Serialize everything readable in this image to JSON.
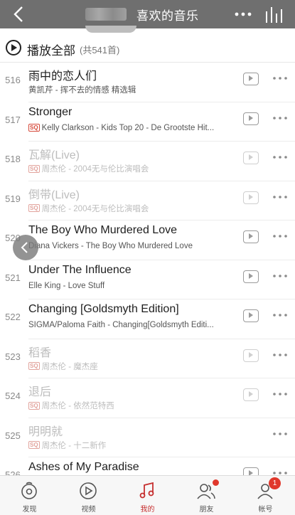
{
  "header": {
    "title": "喜欢的音乐"
  },
  "play_all": {
    "label": "播放全部",
    "count": "(共541首)"
  },
  "songs": [
    {
      "index": "516",
      "name": "雨中的恋人们",
      "sub": "黄凯芹 - 挥不去的情感 精选辑",
      "sq": false,
      "mv": true,
      "available": true
    },
    {
      "index": "517",
      "name": "Stronger",
      "sub": "Kelly Clarkson - Kids Top 20 - De Grootste Hit...",
      "sq": true,
      "mv": true,
      "available": true
    },
    {
      "index": "518",
      "name": "瓦解(Live)",
      "sub": "周杰伦 - 2004无与伦比演唱会",
      "sq": true,
      "mv": true,
      "available": false
    },
    {
      "index": "519",
      "name": "倒带(Live)",
      "sub": "周杰伦 - 2004无与伦比演唱会",
      "sq": true,
      "mv": true,
      "available": false
    },
    {
      "index": "520",
      "name": "The Boy Who Murdered Love",
      "sub": "Diana Vickers - The Boy Who Murdered Love",
      "sq": false,
      "mv": true,
      "available": true
    },
    {
      "index": "521",
      "name": "Under The Influence",
      "sub": "Elle King - Love Stuff",
      "sq": false,
      "mv": true,
      "available": true
    },
    {
      "index": "522",
      "name": "Changing [Goldsmyth Edition]",
      "sub": "SIGMA/Paloma Faith - Changing[Goldsmyth Editi...",
      "sq": false,
      "mv": true,
      "available": true
    },
    {
      "index": "523",
      "name": "稻香",
      "sub": "周杰伦 - 魔杰座",
      "sq": true,
      "mv": true,
      "available": false
    },
    {
      "index": "524",
      "name": "退后",
      "sub": "周杰伦 - 依然范特西",
      "sq": true,
      "mv": true,
      "available": false
    },
    {
      "index": "525",
      "name": "明明就",
      "sub": "周杰伦 - 十二新作",
      "sq": true,
      "mv": false,
      "available": false
    },
    {
      "index": "526",
      "name": "Ashes of My Paradise",
      "sub": "",
      "sq": false,
      "mv": true,
      "available": true
    }
  ],
  "sq_badge": "SQ",
  "tabs": [
    {
      "label": "发现",
      "icon": "disc-icon",
      "active": false
    },
    {
      "label": "视频",
      "icon": "video-icon",
      "active": false
    },
    {
      "label": "我的",
      "icon": "music-note-icon",
      "active": true
    },
    {
      "label": "朋友",
      "icon": "friends-icon",
      "active": false,
      "dot": true
    },
    {
      "label": "帐号",
      "icon": "account-icon",
      "active": false,
      "badge": "1"
    }
  ],
  "colors": {
    "header_bg": "#6f6f6f",
    "accent": "#c62f2f",
    "badge": "#e0382c"
  }
}
